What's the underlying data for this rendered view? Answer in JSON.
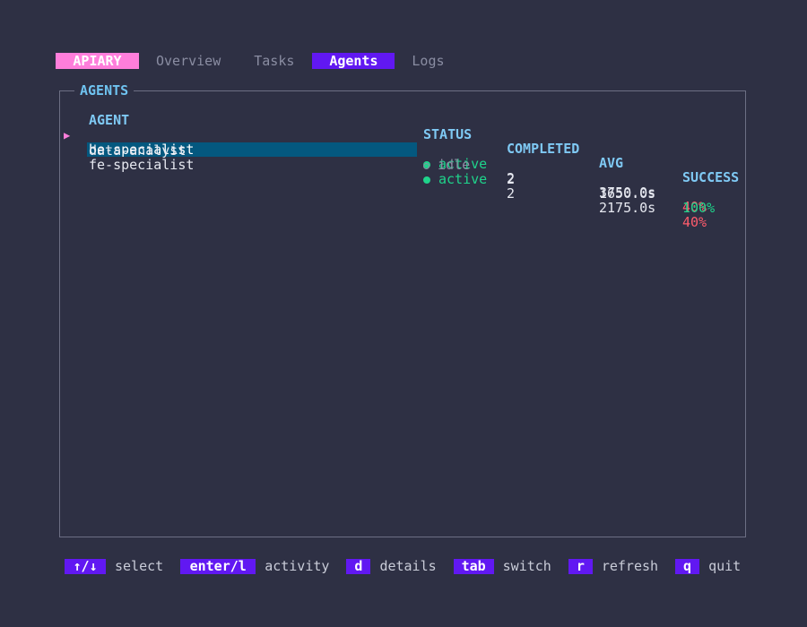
{
  "tabbar": {
    "brand": "APIARY",
    "tabs": [
      {
        "label": "Overview",
        "active": false
      },
      {
        "label": "Tasks",
        "active": false
      },
      {
        "label": "Agents",
        "active": true
      },
      {
        "label": "Logs",
        "active": false
      }
    ]
  },
  "panel": {
    "title": "AGENTS",
    "columns": {
      "agent": "AGENT",
      "status": "STATUS",
      "completed": "COMPLETED",
      "avg": "AVG",
      "success": "SUCCESS"
    },
    "cursor_glyph": "▶",
    "rows": [
      {
        "agent": "be-specialist",
        "status": "active",
        "completed": "2",
        "avg": "3750.0s",
        "success": "40%",
        "selected": true
      },
      {
        "agent": "data-analyst",
        "status": "idle",
        "completed": "2",
        "avg": "1650.0s",
        "success": "100%",
        "selected": false
      },
      {
        "agent": "fe-specialist",
        "status": "active",
        "completed": "2",
        "avg": "2175.0s",
        "success": "40%",
        "selected": false
      }
    ]
  },
  "footer": {
    "hints": [
      {
        "key": "↑/↓",
        "desc": "select"
      },
      {
        "key": "enter/l",
        "desc": "activity"
      },
      {
        "key": "d",
        "desc": "details"
      },
      {
        "key": "tab",
        "desc": "switch"
      },
      {
        "key": "r",
        "desc": "refresh"
      },
      {
        "key": "q",
        "desc": "quit"
      }
    ]
  },
  "colors": {
    "background": "#2e3044",
    "brand": "#ff7edb",
    "accent": "#6118f2",
    "header": "#7fc9f4",
    "selection": "#04587f",
    "active": "#1fd38b",
    "danger": "#ff5c6c",
    "muted": "#8a8da2"
  }
}
